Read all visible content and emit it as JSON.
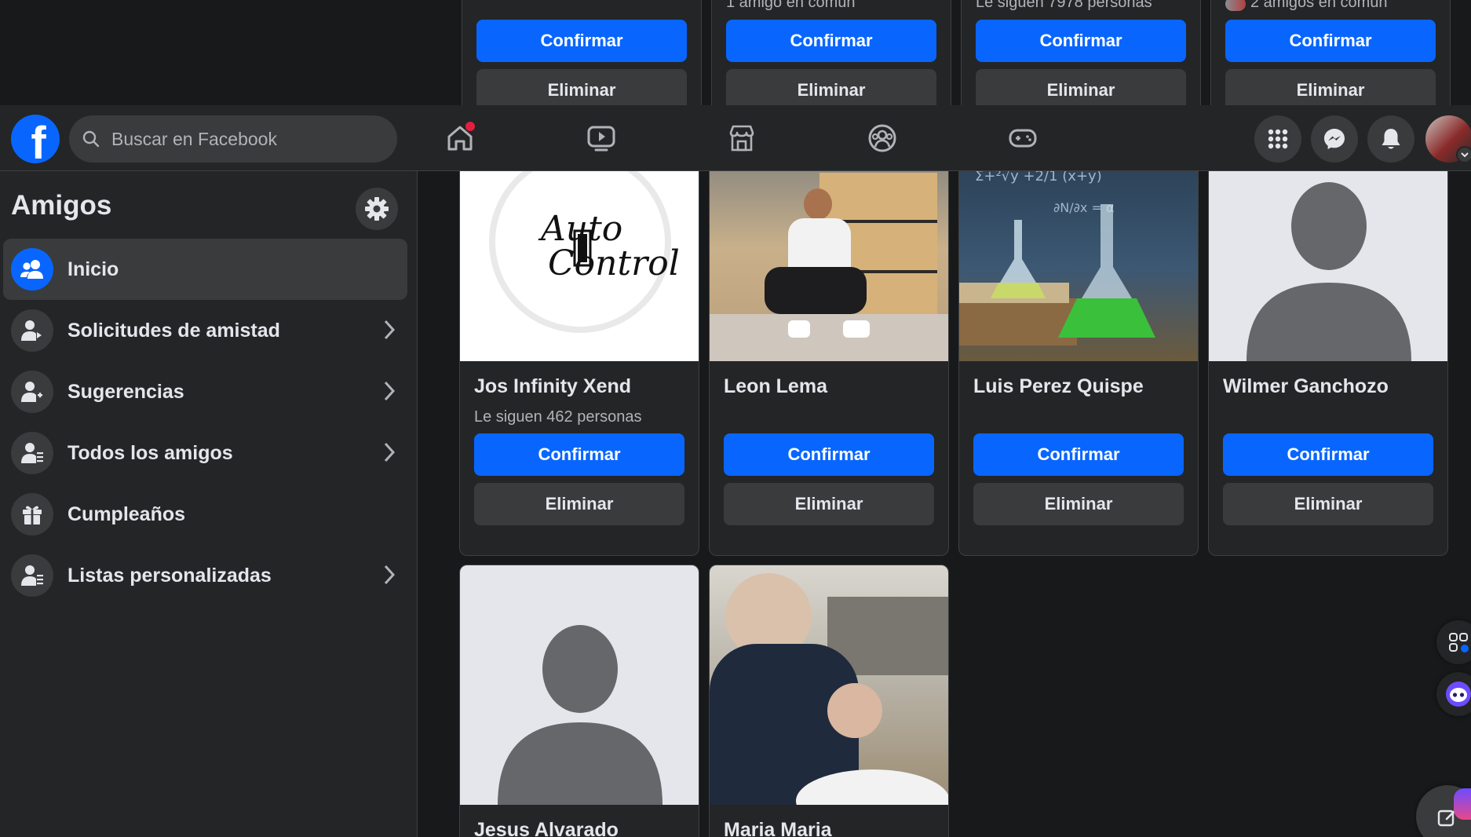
{
  "header": {
    "logo": "f",
    "search_placeholder": "Buscar en Facebook",
    "nav_icons": [
      "home-icon",
      "video-icon",
      "marketplace-icon",
      "groups-icon",
      "gaming-icon"
    ],
    "right_icons": [
      "menu-grid-icon",
      "messenger-icon",
      "bell-icon"
    ],
    "colors": {
      "header_bg": "#242526",
      "accent": "#0866ff",
      "badge": "#e41e3f"
    }
  },
  "sidebar": {
    "title": "Amigos",
    "items": [
      {
        "label": "Inicio",
        "icon": "friends-icon",
        "active": true,
        "chevron": false
      },
      {
        "label": "Solicitudes de amistad",
        "icon": "friend-requests-icon",
        "active": false,
        "chevron": true
      },
      {
        "label": "Sugerencias",
        "icon": "suggestions-icon",
        "active": false,
        "chevron": true
      },
      {
        "label": "Todos los amigos",
        "icon": "all-friends-icon",
        "active": false,
        "chevron": true
      },
      {
        "label": "Cumpleaños",
        "icon": "gift-icon",
        "active": false,
        "chevron": false
      },
      {
        "label": "Listas personalizadas",
        "icon": "custom-lists-icon",
        "active": false,
        "chevron": true
      }
    ]
  },
  "top_row": [
    {
      "subtitle": "",
      "confirm": "Confirmar",
      "delete": "Eliminar"
    },
    {
      "subtitle": "1 amigo en común",
      "confirm": "Confirmar",
      "delete": "Eliminar"
    },
    {
      "subtitle": "Le siguen 7978 personas",
      "confirm": "Confirmar",
      "delete": "Eliminar"
    },
    {
      "subtitle": "2 amigos en común",
      "confirm": "Confirmar",
      "delete": "Eliminar"
    }
  ],
  "requests": [
    {
      "name": "Jos Infinity Xend",
      "subtitle": "Le siguen 462 personas",
      "confirm": "Confirmar",
      "delete": "Eliminar",
      "photo_text_1": "Auto",
      "photo_text_2": "Control"
    },
    {
      "name": "Leon Lema",
      "subtitle": "",
      "confirm": "Confirmar",
      "delete": "Eliminar"
    },
    {
      "name": "Luis Perez Quispe",
      "subtitle": "",
      "confirm": "Confirmar",
      "delete": "Eliminar"
    },
    {
      "name": "Wilmer Ganchozo",
      "subtitle": "",
      "confirm": "Confirmar",
      "delete": "Eliminar"
    },
    {
      "name": "Jesus Alvarado",
      "subtitle": ""
    },
    {
      "name": "Maria Maria",
      "subtitle": ""
    }
  ]
}
